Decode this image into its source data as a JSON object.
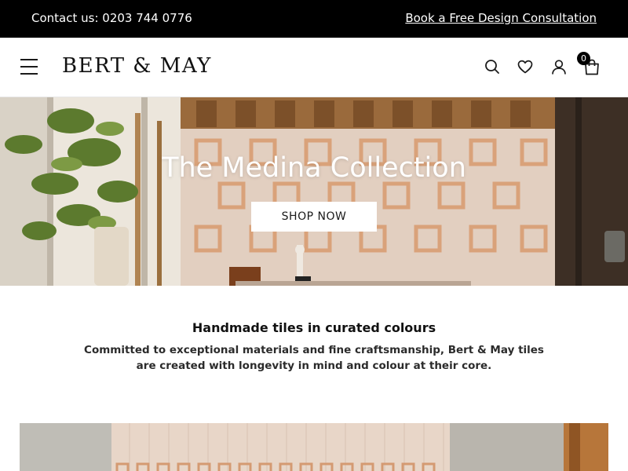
{
  "topbar": {
    "contact": "Contact us: 0203 744 0776",
    "consultation_link": "Book a Free Design Consultation"
  },
  "header": {
    "brand": "BERT & MAY",
    "icons": [
      "menu-icon",
      "search-icon",
      "heart-icon",
      "user-icon",
      "bag-icon"
    ],
    "cart_count": "0"
  },
  "hero": {
    "title": "The Medina Collection",
    "cta_label": "SHOP NOW"
  },
  "intro": {
    "title": "Handmade tiles in curated colours",
    "body": "Committed to exceptional materials and fine craftsmanship, Bert & May tiles are created with longevity in mind and colour at their core."
  },
  "colors": {
    "topbar_bg": "#000000",
    "tile_light": "#e7d2c2",
    "tile_accent": "#d29a6e",
    "wood": "#6e4a2a"
  }
}
